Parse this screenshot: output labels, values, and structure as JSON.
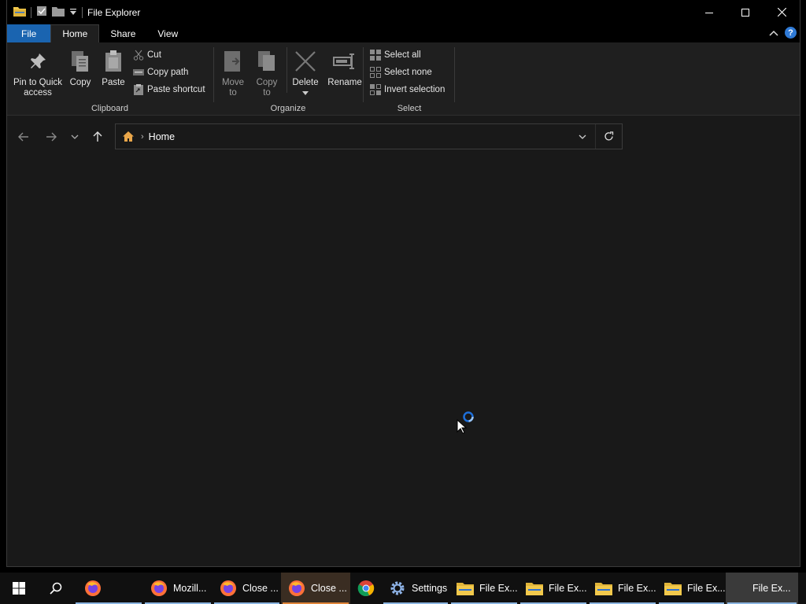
{
  "window": {
    "title": "File Explorer"
  },
  "ribbon_tabs": [
    "File",
    "Home",
    "Share",
    "View"
  ],
  "clipboard": {
    "group_label": "Clipboard",
    "pin_label_1": "Pin to Quick",
    "pin_label_2": "access",
    "copy": "Copy",
    "paste": "Paste",
    "cut": "Cut",
    "copy_path": "Copy path",
    "paste_shortcut": "Paste shortcut"
  },
  "organize": {
    "group_label": "Organize",
    "move_1": "Move",
    "move_2": "to",
    "copy_1": "Copy",
    "copy_2": "to",
    "delete": "Delete",
    "rename": "Rename"
  },
  "select": {
    "group_label": "Select",
    "select_all": "Select all",
    "select_none": "Select none",
    "invert_selection": "Invert selection"
  },
  "address": {
    "crumb": "Home"
  },
  "help": "?",
  "taskbar": {
    "items": [
      {
        "label": "Mozill..."
      },
      {
        "label": "Close ..."
      },
      {
        "label": "Close ..."
      },
      {
        "label": "Settings"
      },
      {
        "label": "File Ex..."
      },
      {
        "label": "File Ex..."
      },
      {
        "label": "File Ex..."
      },
      {
        "label": "File Ex..."
      },
      {
        "label": "File Ex..."
      }
    ]
  },
  "colors": {
    "file_tab": "#1a64b0",
    "accent_underline": "#8ab4e0",
    "folder_yellow": "#f2c94c"
  }
}
